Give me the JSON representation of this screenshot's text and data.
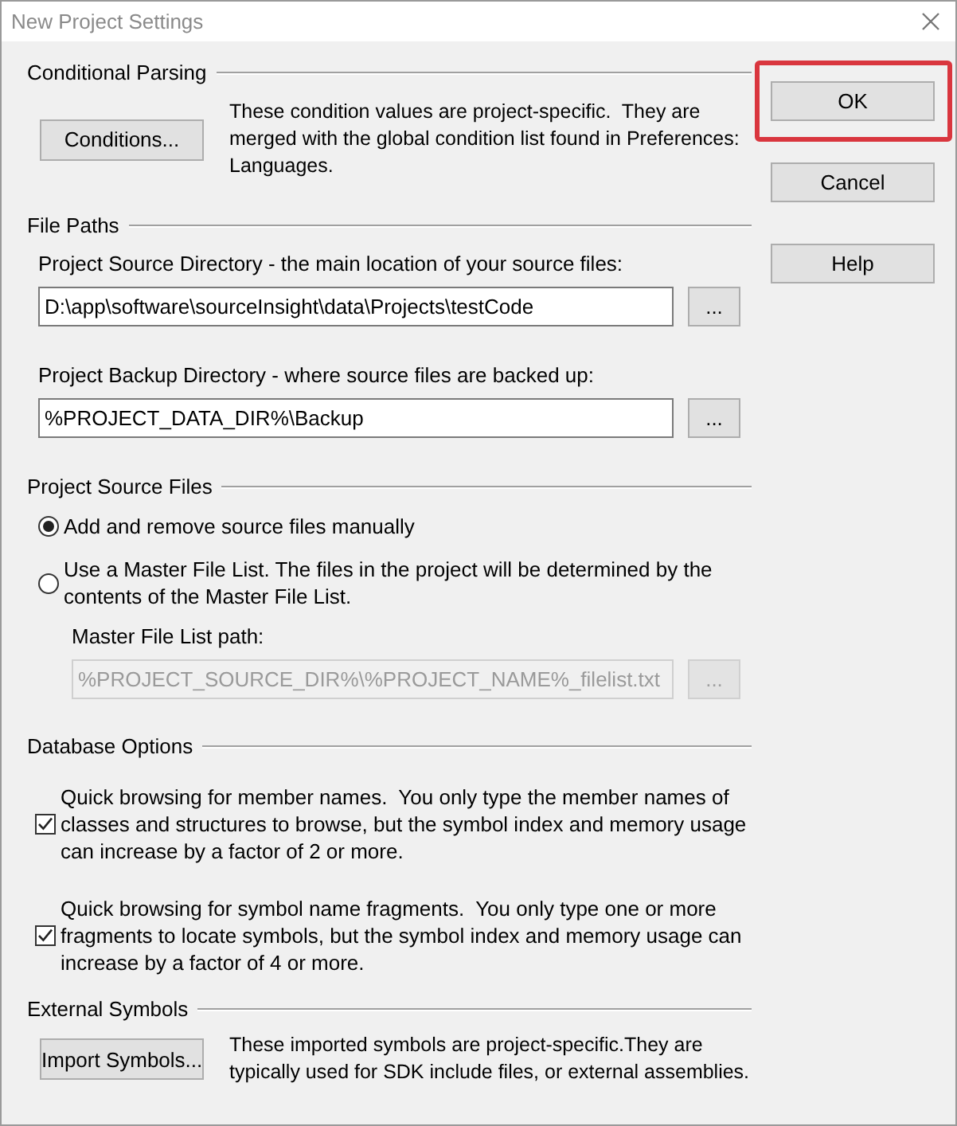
{
  "window": {
    "title": "New Project Settings"
  },
  "conditional_parsing": {
    "heading": "Conditional Parsing",
    "button": "Conditions...",
    "description": "These condition values are project-specific.  They are merged with the global condition list found in Preferences: Languages."
  },
  "file_paths": {
    "heading": "File Paths",
    "fields": [
      {
        "label": "Project Source Directory - the main location of your source files:",
        "value": "D:\\app\\software\\sourceInsight\\data\\Projects\\testCode",
        "browse": "..."
      },
      {
        "label": "Project Backup Directory - where source files are backed up:",
        "value": "%PROJECT_DATA_DIR%\\Backup",
        "browse": "..."
      }
    ]
  },
  "project_source_files": {
    "heading": "Project Source Files",
    "options": [
      {
        "label": "Add and remove source files manually",
        "selected": true
      },
      {
        "label": "Use a Master File List. The files in the project will be determined by the contents of the Master File List.",
        "selected": false
      }
    ],
    "master_list": {
      "label": "Master File List path:",
      "value": "%PROJECT_SOURCE_DIR%\\%PROJECT_NAME%_filelist.txt",
      "browse": "...",
      "disabled": true
    }
  },
  "database_options": {
    "heading": "Database Options",
    "options": [
      {
        "label": "Quick browsing for member names.  You only type the member names of classes and structures to browse, but the symbol index and memory usage can increase by a factor of 2 or more.",
        "checked": true
      },
      {
        "label": "Quick browsing for symbol name fragments.  You only type one or more fragments to locate symbols, but the symbol index and memory usage can increase by a factor of 4 or more.",
        "checked": true
      }
    ]
  },
  "external_symbols": {
    "heading": "External Symbols",
    "button": "Import Symbols...",
    "description": "These imported symbols are project-specific.They are typically used for SDK include files, or external assemblies."
  },
  "buttons": [
    {
      "label": "OK",
      "highlighted": true
    },
    {
      "label": "Cancel",
      "highlighted": false
    },
    {
      "label": "Help",
      "highlighted": false
    }
  ]
}
